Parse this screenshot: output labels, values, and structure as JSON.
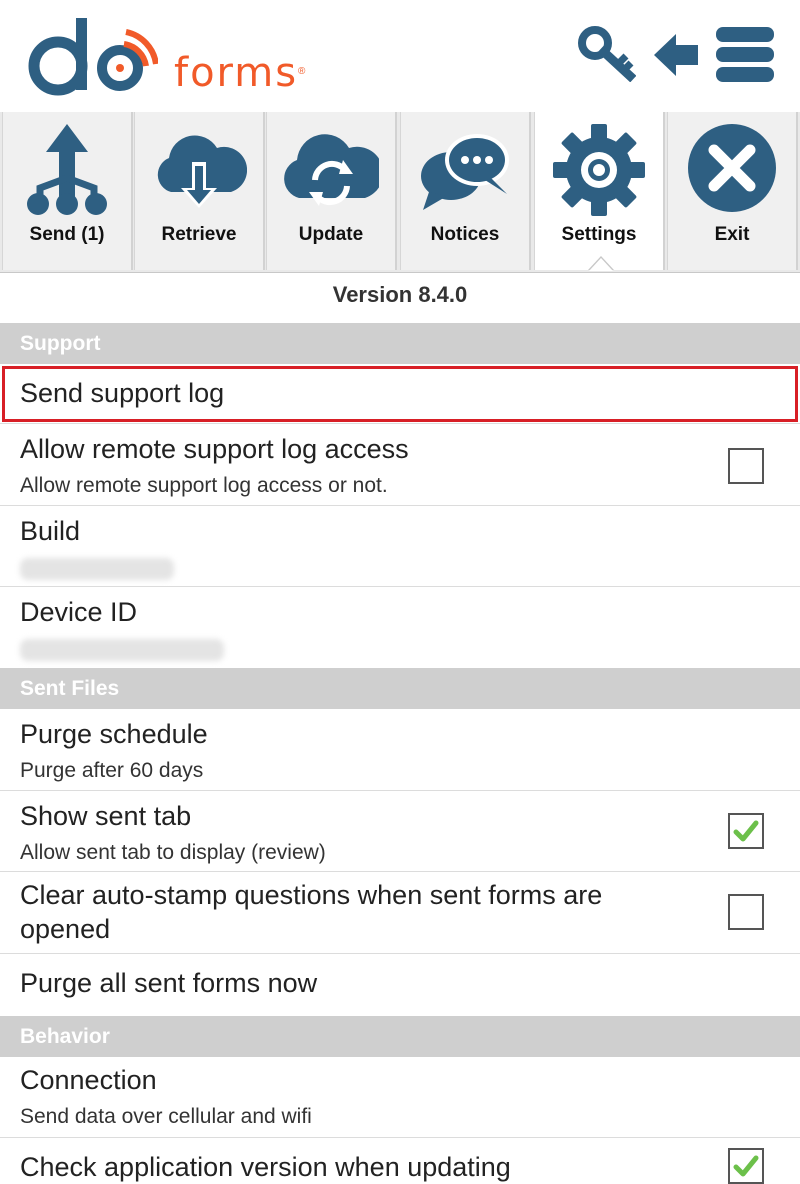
{
  "header": {
    "logo_text": "forms",
    "logo_mark": "®",
    "icons": [
      "key-icon",
      "back-arrow-icon",
      "menu-icon"
    ]
  },
  "toolbar": {
    "buttons": [
      {
        "label": "Send (1)",
        "icon": "send-upload-icon"
      },
      {
        "label": "Retrieve",
        "icon": "cloud-download-icon"
      },
      {
        "label": "Update",
        "icon": "cloud-sync-icon"
      },
      {
        "label": "Notices",
        "icon": "chat-bubbles-icon"
      },
      {
        "label": "Settings",
        "icon": "gear-icon",
        "active": true
      },
      {
        "label": "Exit",
        "icon": "close-circle-icon"
      }
    ]
  },
  "version": "Version 8.4.0",
  "sections": {
    "support": "Support",
    "sent_files": "Sent Files",
    "behavior": "Behavior"
  },
  "rows": {
    "send_support_log": {
      "title": "Send support log"
    },
    "remote_log": {
      "title": "Allow remote support log access",
      "sub": "Allow remote support log access or not.",
      "checked": false
    },
    "build": {
      "title": "Build"
    },
    "device_id": {
      "title": "Device ID"
    },
    "purge_schedule": {
      "title": "Purge schedule",
      "sub": "Purge after 60 days"
    },
    "show_sent_tab": {
      "title": "Show sent tab",
      "sub": "Allow sent tab to display (review)",
      "checked": true
    },
    "clear_autostamp": {
      "title_line1": "Clear auto-stamp questions when sent forms are",
      "title_line2": "opened",
      "checked": false
    },
    "purge_all": {
      "title": "Purge all sent forms now"
    },
    "connection": {
      "title": "Connection",
      "sub": "Send data over cellular and wifi"
    },
    "check_version": {
      "title": "Check application version when updating",
      "checked": true
    }
  },
  "colors": {
    "brand_blue": "#2e5f82",
    "brand_orange": "#f15a29",
    "highlight_red": "#d81f26",
    "check_green": "#6cc04a",
    "section_gray": "#cfcfcf"
  }
}
